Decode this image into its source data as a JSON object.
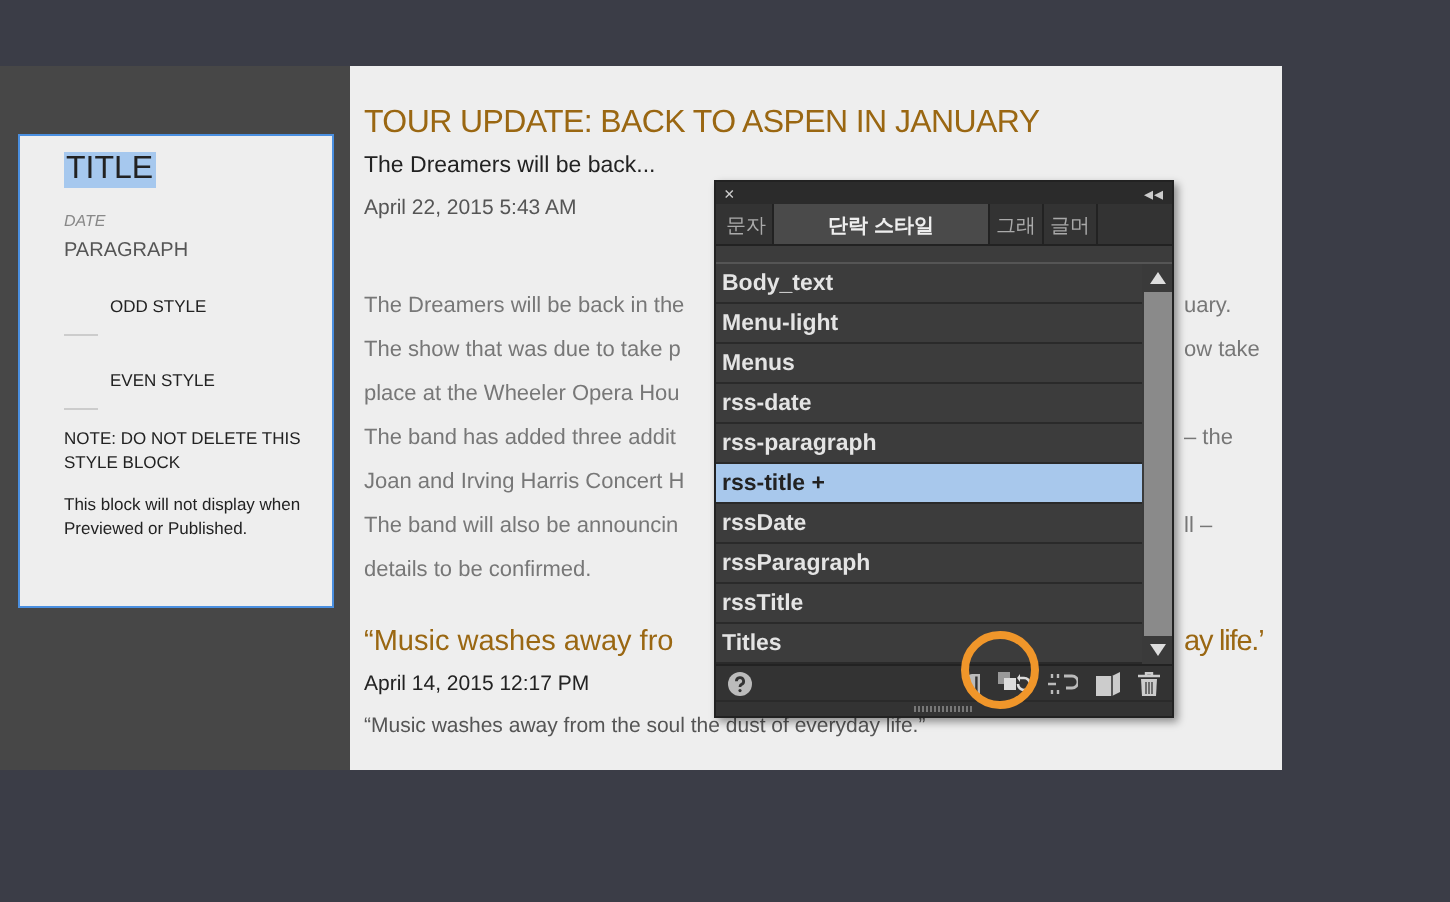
{
  "style_block": {
    "title": "TITLE",
    "title_selected": true,
    "date": "DATE",
    "paragraph": "PARAGRAPH",
    "odd_style": "ODD STYLE",
    "even_style": "EVEN STYLE",
    "note": "NOTE: DO NOT DELETE THIS STYLE BLOCK",
    "info": "This block will not display when Previewed or Published."
  },
  "article": {
    "title": "TOUR UPDATE: BACK TO ASPEN IN JANUARY",
    "subtitle": "The Dreamers will be back...",
    "date": "April 22, 2015 5:43 AM",
    "lines": [
      {
        "left": "The Dreamers will be back in the",
        "right": "uary."
      },
      {
        "left": "The show that was due to take p",
        "right": "ow take"
      },
      {
        "left": "place at the Wheeler Opera Hou"
      },
      {
        "left": "The band has added three addit",
        "right": "– the"
      },
      {
        "left": "Joan and Irving Harris Concert H"
      },
      {
        "left": "The band will also be announcin",
        "right": "ll –"
      },
      {
        "left": "details to be confirmed."
      }
    ]
  },
  "quote": {
    "title_left": "“Music washes away fro",
    "title_right": "ay life.’",
    "date": "April 14, 2015 12:17 PM",
    "text": "“Music washes away from the soul the dust of everyday life.”"
  },
  "panel": {
    "close": "×",
    "collapse": "◂◂",
    "tabs": [
      {
        "label": "문자",
        "selected": false
      },
      {
        "label": "단락 스타일",
        "selected": true
      },
      {
        "label": "그래",
        "selected": false
      },
      {
        "label": "글머",
        "selected": false
      }
    ],
    "styles": [
      {
        "name": "Body_text",
        "selected": false
      },
      {
        "name": "Menu-light",
        "selected": false
      },
      {
        "name": "Menus",
        "selected": false
      },
      {
        "name": "rss-date",
        "selected": false
      },
      {
        "name": "rss-paragraph",
        "selected": false
      },
      {
        "name": "rss-title +",
        "selected": true
      },
      {
        "name": "rssDate",
        "selected": false
      },
      {
        "name": "rssParagraph",
        "selected": false
      },
      {
        "name": "rssTitle",
        "selected": false
      },
      {
        "name": "Titles",
        "selected": false
      }
    ]
  }
}
